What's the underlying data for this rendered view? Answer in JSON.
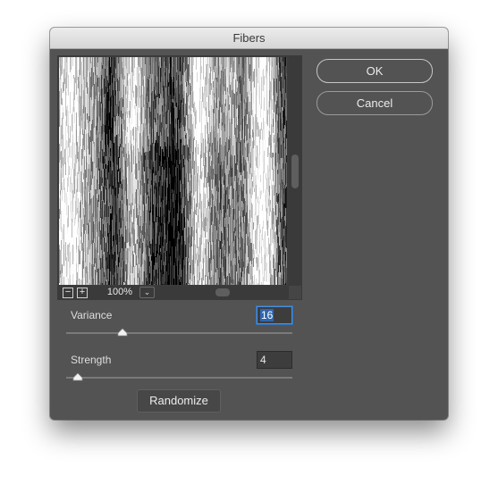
{
  "window": {
    "title": "Fibers"
  },
  "preview": {
    "zoom": "100%",
    "zoom_out_icon": "minus-box-icon",
    "zoom_in_icon": "plus-box-icon",
    "zoom_menu_icon": "chevron-down-icon"
  },
  "buttons": {
    "ok": "OK",
    "cancel": "Cancel",
    "randomize": "Randomize"
  },
  "variance": {
    "label": "Variance",
    "value": "16",
    "fraction": 0.25
  },
  "strength": {
    "label": "Strength",
    "value": "4",
    "fraction": 0.05
  }
}
